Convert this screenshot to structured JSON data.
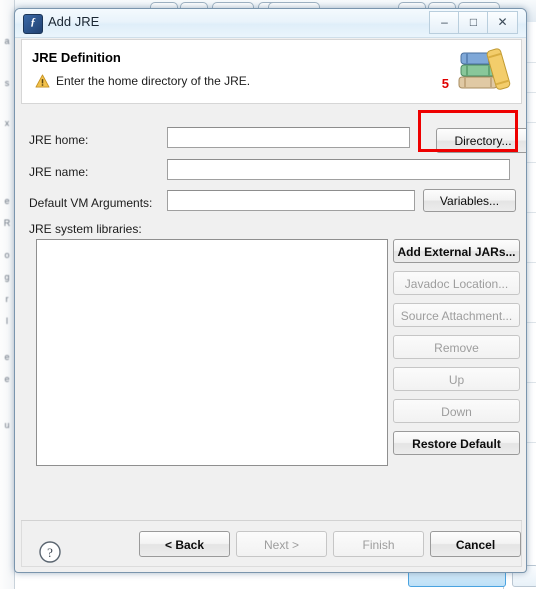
{
  "window": {
    "title": "Add JRE",
    "icon": "eclipse-jre-icon",
    "controls": [
      {
        "name": "minimize-button",
        "glyph": "–"
      },
      {
        "name": "maximize-button",
        "glyph": "□"
      },
      {
        "name": "close-button",
        "glyph": "✕"
      }
    ]
  },
  "header": {
    "title": "JRE Definition",
    "message": "Enter the home directory of the JRE.",
    "warning_icon": "warning-triangle-icon",
    "marker": "5",
    "marker_color": "#e00000",
    "decoration_icon": "books-icon"
  },
  "form": {
    "jre_home": {
      "label": "JRE home:",
      "value": "",
      "placeholder": ""
    },
    "jre_name": {
      "label": "JRE name:",
      "value": "",
      "placeholder": ""
    },
    "default_vm_arguments": {
      "label": "Default VM Arguments:",
      "value": "",
      "placeholder": ""
    },
    "directory_button": "Directory...",
    "variables_button": "Variables..."
  },
  "libraries": {
    "label": "JRE system libraries:",
    "items": [],
    "buttons": [
      {
        "label": "Add External JARs...",
        "enabled": true
      },
      {
        "label": "Javadoc Location...",
        "enabled": false
      },
      {
        "label": "Source Attachment...",
        "enabled": false
      },
      {
        "label": "Remove",
        "enabled": false
      },
      {
        "label": "Up",
        "enabled": false
      },
      {
        "label": "Down",
        "enabled": false
      },
      {
        "label": "Restore Default",
        "enabled": true
      }
    ]
  },
  "footer": {
    "help_icon": "help-question-icon",
    "buttons": [
      {
        "label": "< Back",
        "enabled": true
      },
      {
        "label": "Next >",
        "enabled": false
      },
      {
        "label": "Finish",
        "enabled": false
      },
      {
        "label": "Cancel",
        "enabled": true
      }
    ]
  },
  "annotation": {
    "highlight_color": "#ee0000",
    "highlight_target": "Directory..."
  },
  "background": {
    "left_edge_text": "a s x e R o g r l e e u",
    "bottom_button": ""
  }
}
